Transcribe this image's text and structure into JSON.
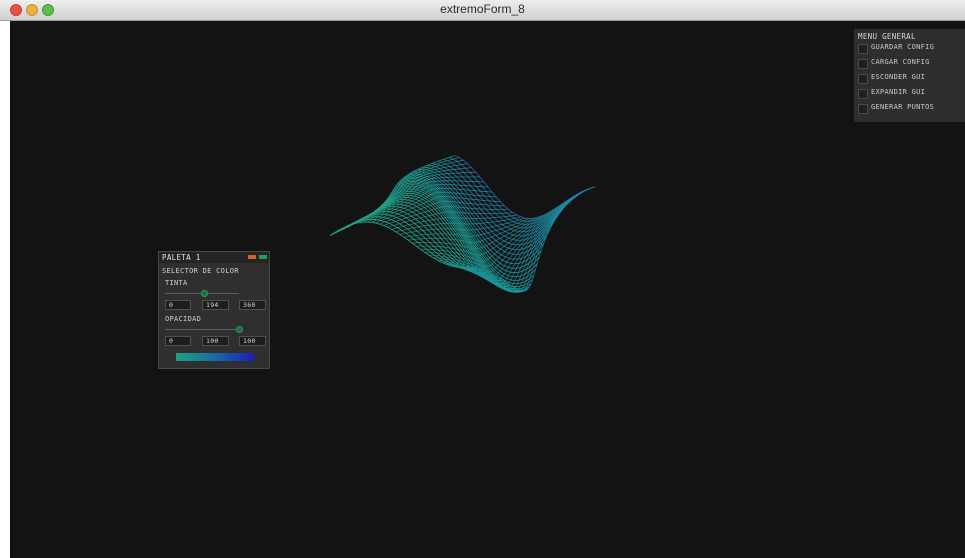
{
  "window": {
    "title": "extremoForm_8"
  },
  "menu_general": {
    "title": "MENU GENERAL",
    "items": [
      {
        "label": "GUARDAR CONFIG",
        "checked": false
      },
      {
        "label": "CARGAR CONFIG",
        "checked": false
      },
      {
        "label": "ESCONDER GUI",
        "checked": false
      },
      {
        "label": "EXPANDIR GUI",
        "checked": false
      },
      {
        "label": "GENERAR PUNTOS",
        "checked": false
      }
    ]
  },
  "palette": {
    "title": "PALETA 1",
    "section": "SELECTOR DE COLOR",
    "tinta": {
      "label": "TINTA",
      "min": "0",
      "value": "194",
      "max": "360",
      "level": 0.54
    },
    "opacidad": {
      "label": "OPACIDAD",
      "min": "0",
      "value": "100",
      "max": "100",
      "level": 1.0
    },
    "gradient_colors": [
      "#1fa37e",
      "#1a6aa6",
      "#1c1fb6"
    ]
  },
  "colors": {
    "canvas_bg": "#131313",
    "mesh_green": "#22a882",
    "mesh_teal": "#1b8fa0",
    "mesh_blue": "#2a4fc4"
  }
}
